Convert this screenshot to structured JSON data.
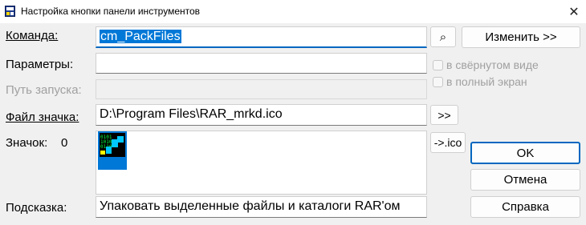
{
  "window": {
    "title": "Настройка кнопки панели инструментов",
    "close_glyph": "✕"
  },
  "labels": {
    "command": "Команда:",
    "params": "Параметры:",
    "startpath": "Путь запуска:",
    "iconfile": "Файл значка:",
    "icon": "Значок:",
    "icon_index": "0",
    "tooltip": "Подсказка:"
  },
  "fields": {
    "command_value": "cm_PackFiles",
    "params_value": "",
    "startpath_value": "",
    "iconfile_value": "D:\\Program Files\\RAR_mrkd.ico",
    "tooltip_value": "Упаковать выделенные файлы и каталоги RAR'ом"
  },
  "buttons": {
    "search_glyph": "⌕",
    "change": "Изменить >>",
    "browse_icon": ">>",
    "to_ico": "->.ico",
    "ok": "OK",
    "cancel": "Отмена",
    "help": "Справка"
  },
  "checkboxes": {
    "minimized": "в свёрнутом виде",
    "fullscreen": "в полный экран"
  },
  "colors": {
    "accent": "#0067c0",
    "selection": "#0078d7"
  }
}
